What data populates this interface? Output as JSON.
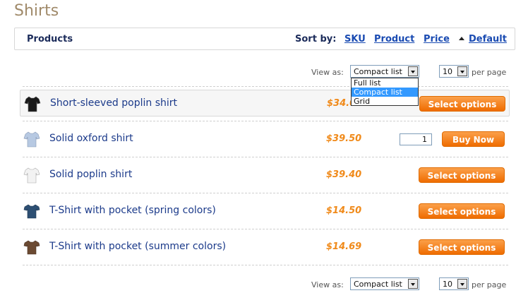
{
  "page": {
    "title": "Shirts"
  },
  "sortbar": {
    "products_label": "Products",
    "sortby_label": "Sort by:",
    "sku": "SKU",
    "product": "Product",
    "price": "Price",
    "default": "Default"
  },
  "view": {
    "label": "View as:",
    "selected": "Compact list",
    "per_page_value": "10",
    "per_page_label": "per page",
    "options": [
      "Full list",
      "Compact list",
      "Grid"
    ]
  },
  "products": [
    {
      "name": "Short-sleeved poplin shirt",
      "price": "$34.00",
      "action": "Select options",
      "thumb_color": "#1a1a1a"
    },
    {
      "name": "Solid oxford shirt",
      "price": "$39.50",
      "action": "Buy Now",
      "qty": "1",
      "thumb_color": "#b7c9e2"
    },
    {
      "name": "Solid poplin shirt",
      "price": "$39.40",
      "action": "Select options",
      "thumb_color": "#f2f2f2"
    },
    {
      "name": "T-Shirt with pocket (spring colors)",
      "price": "$14.50",
      "action": "Select options",
      "thumb_color": "#2d4f73"
    },
    {
      "name": "T-Shirt with pocket (summer colors)",
      "price": "$14.69",
      "action": "Select options",
      "thumb_color": "#6b4a32"
    }
  ],
  "colors": {
    "accent": "#f08a1a",
    "button": "#ef6c00",
    "link": "#1a4bb2"
  }
}
